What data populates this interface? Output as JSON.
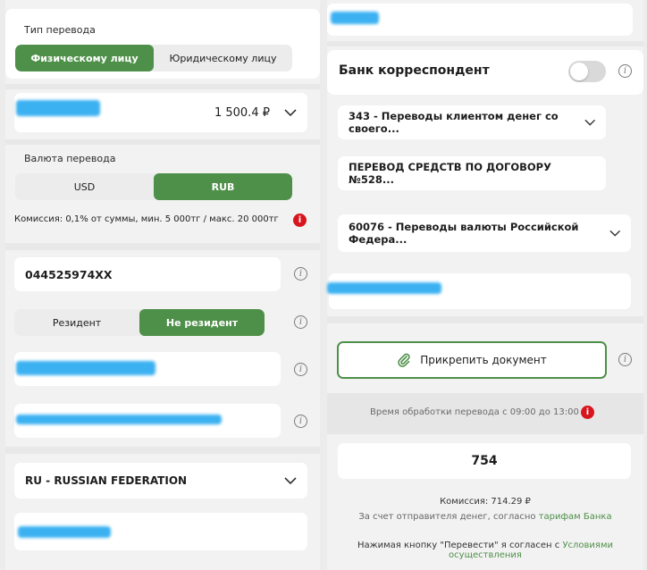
{
  "left": {
    "transfer_type": {
      "label": "Тип перевода",
      "options": [
        "Физическому лицу",
        "Юридическому лицу"
      ],
      "selected": "Физическому лицу"
    },
    "amount": {
      "value": "1 500.4 ₽"
    },
    "currency": {
      "label": "Валюта перевода",
      "options": [
        "USD",
        "RUB"
      ],
      "selected": "RUB"
    },
    "commission_note": "Комиссия: 0,1% от суммы, мин. 5 000тг / макс. 20 000тг",
    "bic": {
      "value": "044525974XX"
    },
    "residency": {
      "options": [
        "Резидент",
        "Не резидент"
      ],
      "selected": "Не резидент"
    },
    "country": {
      "value": "RU - RUSSIAN FEDERATION"
    }
  },
  "right": {
    "correspondent_bank": {
      "label": "Банк корреспондент",
      "enabled": false
    },
    "payment_code": {
      "value": "343 - Переводы клиентом денег со своего..."
    },
    "purpose": {
      "value": "ПЕРЕВОД СРЕДСТВ ПО ДОГОВОРУ №528..."
    },
    "operation_code": {
      "value": "60076 - Переводы валюты Российской Федера..."
    },
    "attach_button": {
      "label": "Прикрепить документ"
    },
    "processing_time": "Время обработки перевода с 09:00 до 13:00",
    "code_input": {
      "value": "754"
    },
    "commission": {
      "label": "Комиссия: 714.29 ₽"
    },
    "sender_note": {
      "text": "За счет отправителя денег, согласно",
      "link": "тарифам Банка"
    },
    "agreement_note": {
      "text": "Нажимая кнопку \"Перевести\" я согласен с",
      "link": "Условиями осуществления"
    }
  },
  "colors": {
    "accent": "#4e9049",
    "alert": "#d8141e",
    "redaction": "#27a9f0"
  }
}
